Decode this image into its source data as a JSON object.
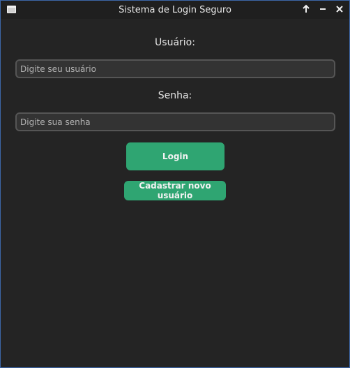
{
  "window": {
    "title": "Sistema de Login Seguro",
    "icon": "app-window-icon",
    "controls": [
      "maximize-arrow-up-icon",
      "minimize-icon",
      "close-icon"
    ]
  },
  "form": {
    "username_label": "Usuário:",
    "username_placeholder": "Digite seu usuário",
    "username_value": "",
    "password_label": "Senha:",
    "password_placeholder": "Digite sua senha",
    "password_value": "",
    "login_button": "Login",
    "register_button": "Cadastrar novo usuário"
  },
  "colors": {
    "background": "#242424",
    "titlebar": "#1f1f1f",
    "input_background": "#333333",
    "input_border": "#555555",
    "button_accent": "#2fa572",
    "text": "#e6e6e6"
  }
}
